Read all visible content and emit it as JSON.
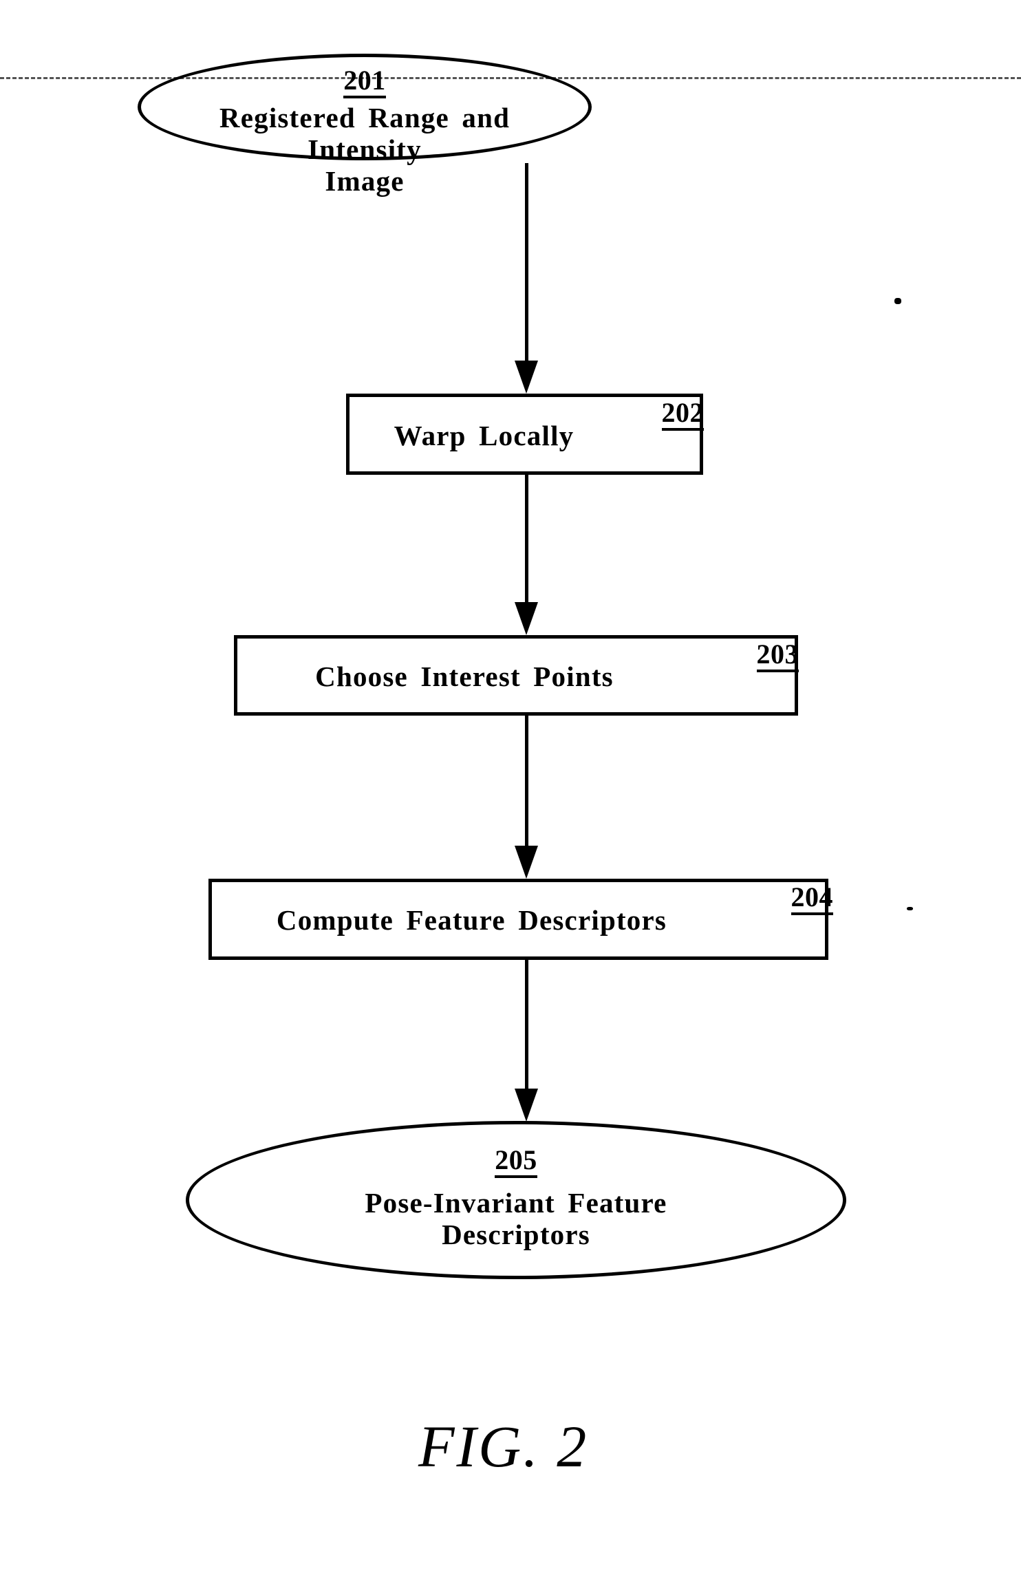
{
  "figure": {
    "caption": "FIG. 2",
    "top_rule": "page-edge-dashed-line"
  },
  "flowchart": {
    "type": "flowchart",
    "orientation": "top-to-bottom",
    "nodes": [
      {
        "id": "201",
        "shape": "ellipse",
        "ref": "201",
        "label_line1": "Registered Range and Intensity",
        "label_line2": "Image",
        "label": "Registered Range and Intensity Image"
      },
      {
        "id": "202",
        "shape": "rectangle",
        "ref": "202",
        "label": "Warp Locally"
      },
      {
        "id": "203",
        "shape": "rectangle",
        "ref": "203",
        "label": "Choose Interest Points"
      },
      {
        "id": "204",
        "shape": "rectangle",
        "ref": "204",
        "label": "Compute Feature Descriptors"
      },
      {
        "id": "205",
        "shape": "ellipse",
        "ref": "205",
        "label_line1": "Pose-Invariant Feature",
        "label_line2": "Descriptors",
        "label": "Pose-Invariant Feature Descriptors"
      }
    ],
    "edges": [
      {
        "from": "201",
        "to": "202",
        "style": "solid-arrow"
      },
      {
        "from": "202",
        "to": "203",
        "style": "solid-arrow"
      },
      {
        "from": "203",
        "to": "204",
        "style": "solid-arrow"
      },
      {
        "from": "204",
        "to": "205",
        "style": "solid-arrow"
      }
    ],
    "colors": {
      "ink": "#000000",
      "paper": "#ffffff"
    }
  }
}
